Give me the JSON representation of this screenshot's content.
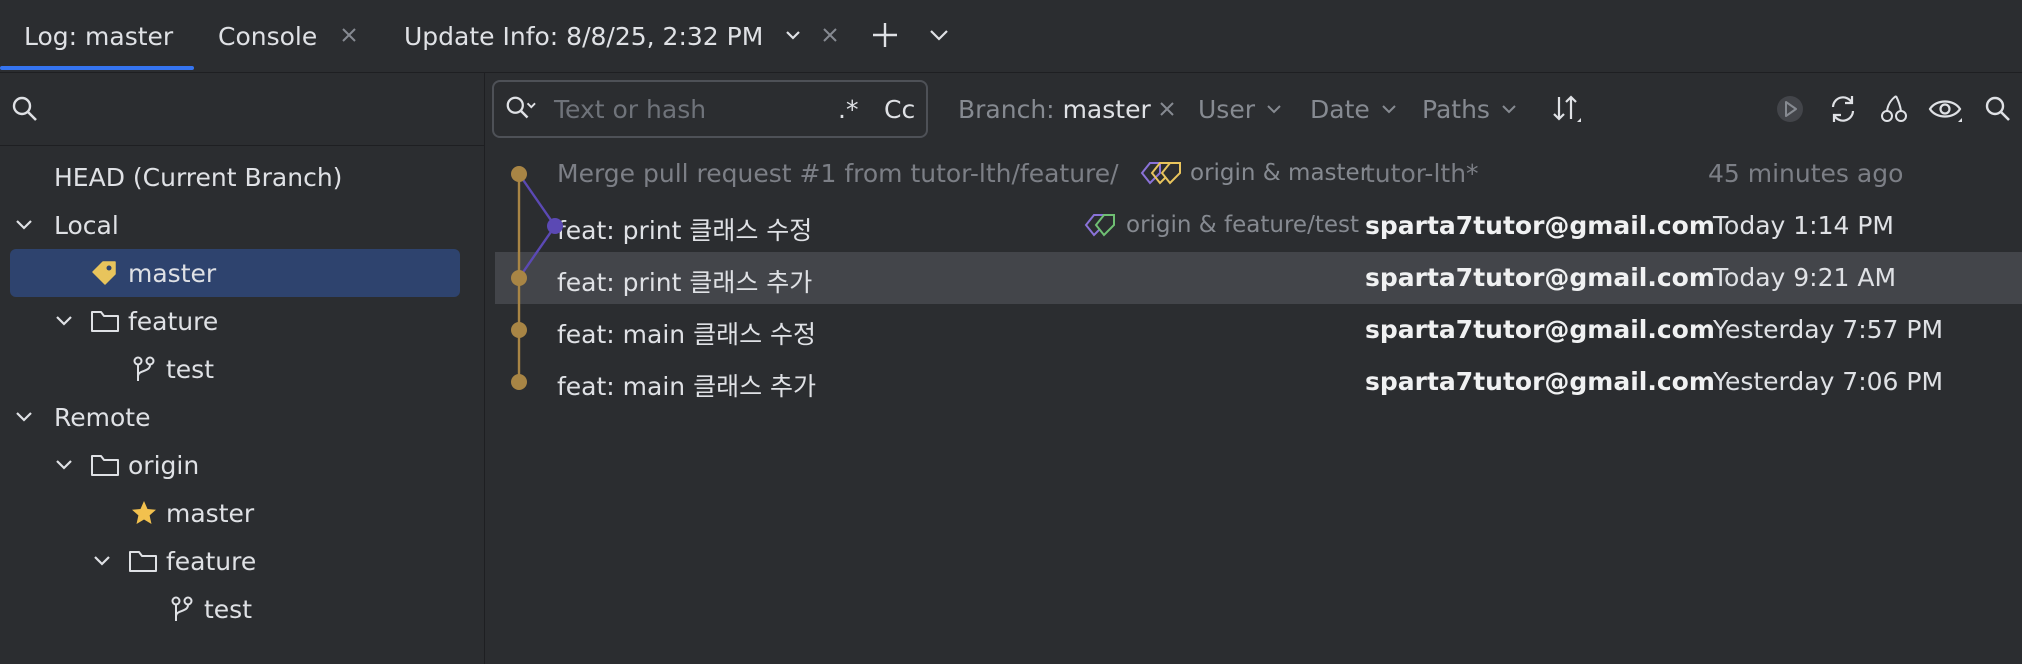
{
  "tabs": [
    {
      "label": "Log: master",
      "active": true
    },
    {
      "label": "Console",
      "closable": true
    },
    {
      "label": "Update Info: 8/8/25, 2:32 PM",
      "closable": true,
      "has_dropdown": true
    }
  ],
  "tabbar_actions": [
    "add-icon",
    "chevron-down-icon"
  ],
  "branches_tree": {
    "search_placeholder": "",
    "head": "HEAD (Current Branch)",
    "local": {
      "label": "Local",
      "master": "master",
      "feature_folder": "feature",
      "feature_test": "test"
    },
    "remote": {
      "label": "Remote",
      "origin_folder": "origin",
      "origin_master": "master",
      "origin_feature_folder": "feature",
      "origin_feature_test": "test"
    }
  },
  "filter": {
    "search_placeholder": "Text or hash",
    "regex_label": ".*",
    "case_label": "Cc",
    "branch_prefix": "Branch:",
    "branch_value": "master",
    "user": "User",
    "date": "Date",
    "paths": "Paths"
  },
  "commits": [
    {
      "message": "Merge pull request #1 from tutor-lth/feature/",
      "refs": "origin & master",
      "author": "tutor-lth*",
      "date": "45 minutes ago",
      "dimmed": true
    },
    {
      "message": "feat: print 클래스 수정",
      "refs": "origin & feature/test",
      "author": "sparta7tutor@gmail.com",
      "date": "Today 1:14 PM"
    },
    {
      "message": "feat: print 클래스 추가",
      "author": "sparta7tutor@gmail.com",
      "date": "Today 9:21 AM",
      "highlighted": true
    },
    {
      "message": "feat: main 클래스 수정",
      "author": "sparta7tutor@gmail.com",
      "date": "Yesterday 7:57 PM"
    },
    {
      "message": "feat: main 클래스 추가",
      "author": "sparta7tutor@gmail.com",
      "date": "Yesterday 7:06 PM"
    }
  ],
  "colors": {
    "background": "#2b2d30",
    "accent": "#3574f0",
    "selection": "#2e436e",
    "row_highlight": "#43454a",
    "graph_master": "#a88545",
    "graph_feature": "#5b49b4",
    "tag_yellow": "#e8c45c",
    "star": "#f2c14e"
  }
}
